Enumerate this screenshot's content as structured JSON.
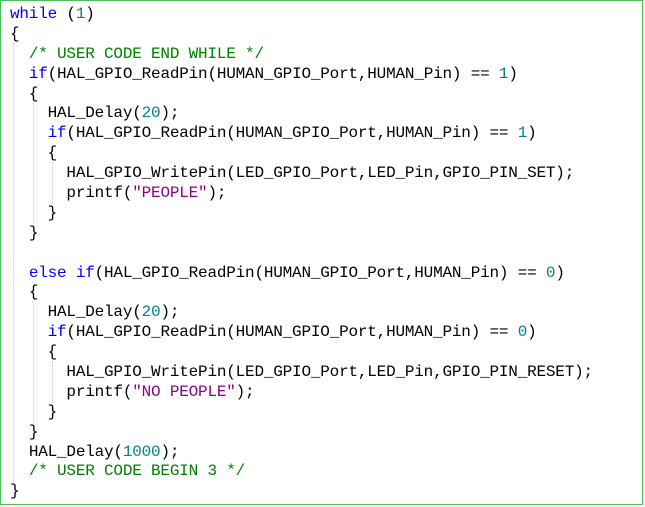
{
  "editor": {
    "lines": [
      {
        "indent": 0,
        "tokens": [
          {
            "t": "kw",
            "v": "while"
          },
          {
            "t": "p",
            "v": " ("
          },
          {
            "t": "num",
            "v": "1"
          },
          {
            "t": "p",
            "v": ")"
          }
        ]
      },
      {
        "indent": 0,
        "tokens": [
          {
            "t": "p",
            "v": "{"
          }
        ]
      },
      {
        "indent": 1,
        "tokens": [
          {
            "t": "cm",
            "v": "/* USER CODE END WHILE */"
          }
        ]
      },
      {
        "indent": 1,
        "tokens": [
          {
            "t": "kw",
            "v": "if"
          },
          {
            "t": "p",
            "v": "(HAL_GPIO_ReadPin(HUMAN_GPIO_Port,HUMAN_Pin) == "
          },
          {
            "t": "num",
            "v": "1"
          },
          {
            "t": "p",
            "v": ")"
          }
        ]
      },
      {
        "indent": 1,
        "tokens": [
          {
            "t": "p",
            "v": "{"
          }
        ]
      },
      {
        "indent": 2,
        "tokens": [
          {
            "t": "p",
            "v": "HAL_Delay("
          },
          {
            "t": "num",
            "v": "20"
          },
          {
            "t": "p",
            "v": ");"
          }
        ]
      },
      {
        "indent": 2,
        "tokens": [
          {
            "t": "kw",
            "v": "if"
          },
          {
            "t": "p",
            "v": "(HAL_GPIO_ReadPin(HUMAN_GPIO_Port,HUMAN_Pin) == "
          },
          {
            "t": "num",
            "v": "1"
          },
          {
            "t": "p",
            "v": ")"
          }
        ]
      },
      {
        "indent": 2,
        "tokens": [
          {
            "t": "p",
            "v": "{"
          }
        ]
      },
      {
        "indent": 3,
        "tokens": [
          {
            "t": "p",
            "v": "HAL_GPIO_WritePin(LED_GPIO_Port,LED_Pin,GPIO_PIN_SET);"
          }
        ]
      },
      {
        "indent": 3,
        "tokens": [
          {
            "t": "p",
            "v": "printf("
          },
          {
            "t": "str",
            "v": "\"PEOPLE\""
          },
          {
            "t": "p",
            "v": ");"
          }
        ]
      },
      {
        "indent": 2,
        "tokens": [
          {
            "t": "p",
            "v": "}"
          }
        ]
      },
      {
        "indent": 1,
        "tokens": [
          {
            "t": "p",
            "v": "}"
          }
        ]
      },
      {
        "indent": 0,
        "tokens": []
      },
      {
        "indent": 1,
        "tokens": [
          {
            "t": "kw",
            "v": "else if"
          },
          {
            "t": "p",
            "v": "(HAL_GPIO_ReadPin(HUMAN_GPIO_Port,HUMAN_Pin) == "
          },
          {
            "t": "num",
            "v": "0"
          },
          {
            "t": "p",
            "v": ")"
          }
        ]
      },
      {
        "indent": 1,
        "tokens": [
          {
            "t": "p",
            "v": "{"
          }
        ]
      },
      {
        "indent": 2,
        "tokens": [
          {
            "t": "p",
            "v": "HAL_Delay("
          },
          {
            "t": "num",
            "v": "20"
          },
          {
            "t": "p",
            "v": ");"
          }
        ]
      },
      {
        "indent": 2,
        "tokens": [
          {
            "t": "kw",
            "v": "if"
          },
          {
            "t": "p",
            "v": "(HAL_GPIO_ReadPin(HUMAN_GPIO_Port,HUMAN_Pin) == "
          },
          {
            "t": "num",
            "v": "0"
          },
          {
            "t": "p",
            "v": ")"
          }
        ]
      },
      {
        "indent": 2,
        "tokens": [
          {
            "t": "p",
            "v": "{"
          }
        ]
      },
      {
        "indent": 3,
        "tokens": [
          {
            "t": "p",
            "v": "HAL_GPIO_WritePin(LED_GPIO_Port,LED_Pin,GPIO_PIN_RESET);"
          }
        ]
      },
      {
        "indent": 3,
        "tokens": [
          {
            "t": "p",
            "v": "printf("
          },
          {
            "t": "str",
            "v": "\"NO PEOPLE\""
          },
          {
            "t": "p",
            "v": ");"
          }
        ]
      },
      {
        "indent": 2,
        "tokens": [
          {
            "t": "p",
            "v": "}"
          }
        ]
      },
      {
        "indent": 1,
        "tokens": [
          {
            "t": "p",
            "v": "}"
          }
        ]
      },
      {
        "indent": 1,
        "tokens": [
          {
            "t": "p",
            "v": "HAL_Delay("
          },
          {
            "t": "num",
            "v": "1000"
          },
          {
            "t": "p",
            "v": ");"
          }
        ]
      },
      {
        "indent": 1,
        "tokens": [
          {
            "t": "cm",
            "v": "/* USER CODE BEGIN 3 */"
          }
        ]
      },
      {
        "indent": 0,
        "tokens": [
          {
            "t": "p",
            "v": "}"
          }
        ]
      }
    ]
  },
  "colors": {
    "keyword": "#0000ff",
    "comment": "#008000",
    "number": "#008080",
    "string": "#8b008b",
    "text": "#000000",
    "border": "#4cc05a"
  }
}
